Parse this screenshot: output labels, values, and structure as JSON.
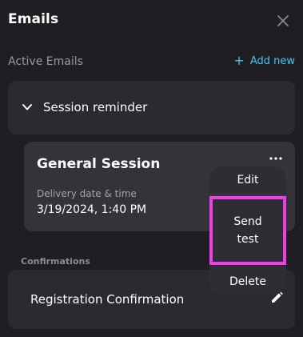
{
  "header": {
    "title": "Emails"
  },
  "section": {
    "label": "Active Emails",
    "add_new_label": "Add new"
  },
  "reminder_group": {
    "label": "Session reminder"
  },
  "session_card": {
    "title": "General Session",
    "delivery_label": "Delivery date & time",
    "delivery_value": "3/19/2024, 1:40 PM"
  },
  "context_menu": {
    "edit_label": "Edit",
    "send_test_line1": "Send",
    "send_test_line2": "test",
    "delete_label": "Delete"
  },
  "confirmations": {
    "label": "Confirmations",
    "item_label": "Registration Confirmation"
  },
  "colors": {
    "background": "#1f1e22",
    "card": "#2b2a30",
    "accent": "#43c6f0",
    "highlight": "#ee3ee8"
  },
  "icons": [
    "close-icon",
    "plus-icon",
    "chevron-down-icon",
    "more-horizontal-icon",
    "pencil-icon"
  ]
}
